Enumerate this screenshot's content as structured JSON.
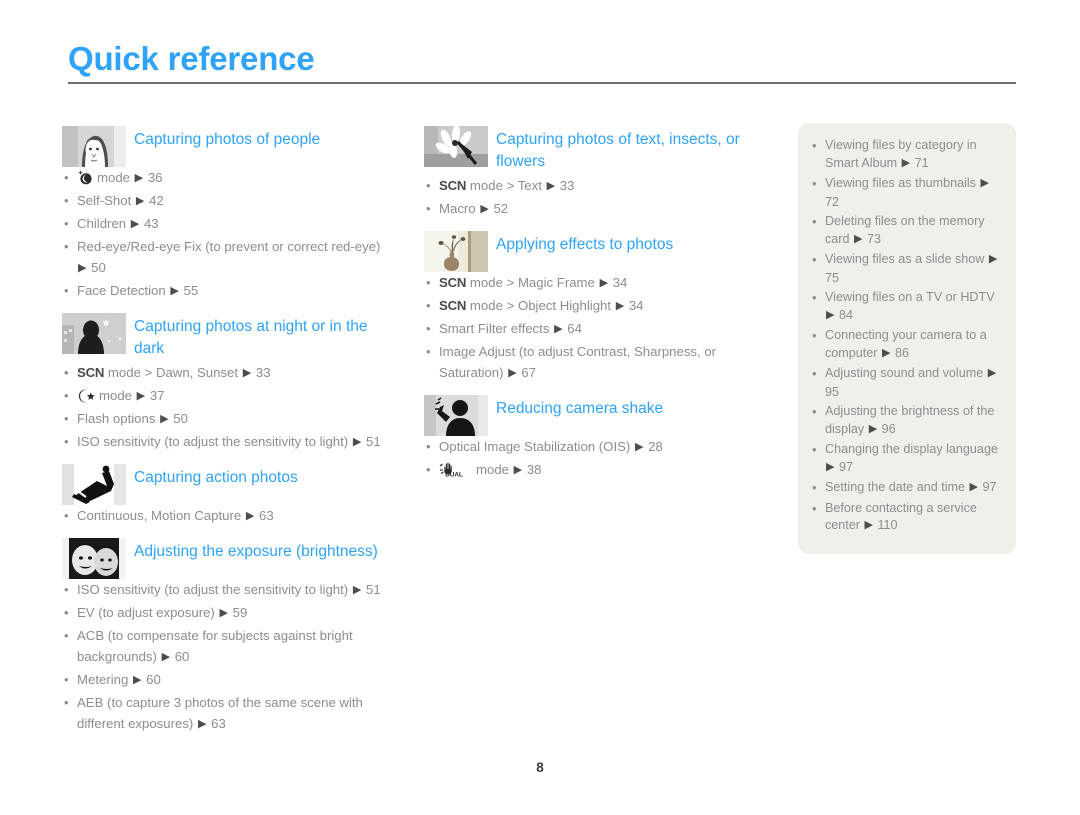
{
  "header": {
    "title": "Quick reference"
  },
  "footer": {
    "page_number": "8"
  },
  "colors": {
    "accent_blue": "#2fa3f7",
    "body_text": "#8d8d8d",
    "panel_bg": "#f0efea",
    "rule": "#6f6f6f"
  },
  "columns": {
    "left": {
      "sections": [
        {
          "thumb_icon": "woman-face-photo-thumbnail",
          "title": "Capturing photos of people",
          "items": [
            {
              "glyph": "beauty-shot-icon",
              "pre": "",
              "bold": "",
              "text": "mode",
              "arrow": "▶",
              "page": "36"
            },
            {
              "glyph": "",
              "pre": "",
              "bold": "",
              "text": "Self-Shot",
              "arrow": "▶",
              "page": "42"
            },
            {
              "glyph": "",
              "pre": "",
              "bold": "",
              "text": "Children",
              "arrow": "▶",
              "page": "43"
            },
            {
              "glyph": "",
              "pre": "",
              "bold": "",
              "text": "Red-eye/Red-eye Fix (to prevent or correct red-eye)",
              "arrow": "▶",
              "page": "50"
            },
            {
              "glyph": "",
              "pre": "",
              "bold": "",
              "text": "Face Detection",
              "arrow": "▶",
              "page": "55"
            }
          ]
        },
        {
          "thumb_icon": "night-scene-photo-thumbnail",
          "title": "Capturing photos at night or in the dark",
          "items": [
            {
              "glyph": "",
              "pre": "",
              "bold": "SCN",
              "text": "mode > Dawn, Sunset",
              "arrow": "▶",
              "page": "33"
            },
            {
              "glyph": "night-mode-icon",
              "pre": "",
              "bold": "",
              "text": "mode",
              "arrow": "▶",
              "page": "37"
            },
            {
              "glyph": "",
              "pre": "",
              "bold": "",
              "text": "Flash options",
              "arrow": "▶",
              "page": "50"
            },
            {
              "glyph": "",
              "pre": "",
              "bold": "",
              "text": "ISO sensitivity (to adjust the sensitivity to light)",
              "arrow": "▶",
              "page": "51"
            }
          ]
        },
        {
          "thumb_icon": "snowboarder-photo-thumbnail",
          "title": "Capturing action photos",
          "items": [
            {
              "glyph": "",
              "pre": "",
              "bold": "",
              "text": "Continuous, Motion Capture",
              "arrow": "▶",
              "page": "63"
            }
          ]
        },
        {
          "thumb_icon": "two-faces-photo-thumbnail",
          "title": "Adjusting the exposure (brightness)",
          "items": [
            {
              "glyph": "",
              "pre": "",
              "bold": "",
              "text": "ISO sensitivity (to adjust the sensitivity to light)",
              "arrow": "▶",
              "page": "51"
            },
            {
              "glyph": "",
              "pre": "",
              "bold": "",
              "text": "EV (to adjust exposure)",
              "arrow": "▶",
              "page": "59"
            },
            {
              "glyph": "",
              "pre": "",
              "bold": "",
              "text": "ACB (to compensate for subjects against bright backgrounds)",
              "arrow": "▶",
              "page": "60"
            },
            {
              "glyph": "",
              "pre": "",
              "bold": "",
              "text": "Metering",
              "arrow": "▶",
              "page": "60"
            },
            {
              "glyph": "",
              "pre": "",
              "bold": "",
              "text": "AEB (to capture 3 photos of the same scene with different exposures)",
              "arrow": "▶",
              "page": "63"
            }
          ]
        }
      ]
    },
    "middle": {
      "sections": [
        {
          "thumb_icon": "flower-insect-photo-thumbnail",
          "title": "Capturing photos of text, insects, or flowers",
          "items": [
            {
              "glyph": "",
              "pre": "",
              "bold": "SCN",
              "text": "mode > Text",
              "arrow": "▶",
              "page": "33"
            },
            {
              "glyph": "",
              "pre": "",
              "bold": "",
              "text": "Macro",
              "arrow": "▶",
              "page": "52"
            }
          ]
        },
        {
          "thumb_icon": "vase-effects-photo-thumbnail",
          "title": "Applying effects to photos",
          "items": [
            {
              "glyph": "",
              "pre": "",
              "bold": "SCN",
              "text": "mode > Magic Frame",
              "arrow": "▶",
              "page": "34"
            },
            {
              "glyph": "",
              "pre": "",
              "bold": "SCN",
              "text": "mode > Object Highlight",
              "arrow": "▶",
              "page": "34"
            },
            {
              "glyph": "",
              "pre": "",
              "bold": "",
              "text": "Smart Filter effects",
              "arrow": "▶",
              "page": "64"
            },
            {
              "glyph": "",
              "pre": "",
              "bold": "",
              "text": "Image Adjust (to adjust Contrast, Sharpness, or Saturation)",
              "arrow": "▶",
              "page": "67"
            }
          ]
        },
        {
          "thumb_icon": "shaking-hand-photo-thumbnail",
          "title": "Reducing camera shake",
          "items": [
            {
              "glyph": "",
              "pre": "",
              "bold": "",
              "text": "Optical Image Stabilization (OIS)",
              "arrow": "▶",
              "page": "28"
            },
            {
              "glyph": "dual-is-icon",
              "pre": "",
              "bold": "",
              "text": "mode",
              "arrow": "▶",
              "page": "38"
            }
          ]
        }
      ]
    },
    "right": {
      "panel_items": [
        {
          "text": "Viewing files by category in Smart Album",
          "arrow": "▶",
          "page": "71"
        },
        {
          "text": "Viewing files as thumbnails",
          "arrow": "▶",
          "page": "72"
        },
        {
          "text": "Deleting files on the memory card",
          "arrow": "▶",
          "page": "73"
        },
        {
          "text": "Viewing files as a slide show",
          "arrow": "▶",
          "page": "75"
        },
        {
          "text": "Viewing files on a TV or HDTV",
          "arrow": "▶",
          "page": "84"
        },
        {
          "text": "Connecting your camera to a computer",
          "arrow": "▶",
          "page": "86"
        },
        {
          "text": "Adjusting sound and volume",
          "arrow": "▶",
          "page": "95"
        },
        {
          "text": "Adjusting the brightness of the display",
          "arrow": "▶",
          "page": "96"
        },
        {
          "text": "Changing the display language",
          "arrow": "▶",
          "page": "97"
        },
        {
          "text": "Setting the date and time",
          "arrow": "▶",
          "page": "97"
        },
        {
          "text": "Before contacting a service center",
          "arrow": "▶",
          "page": "110"
        }
      ]
    }
  }
}
